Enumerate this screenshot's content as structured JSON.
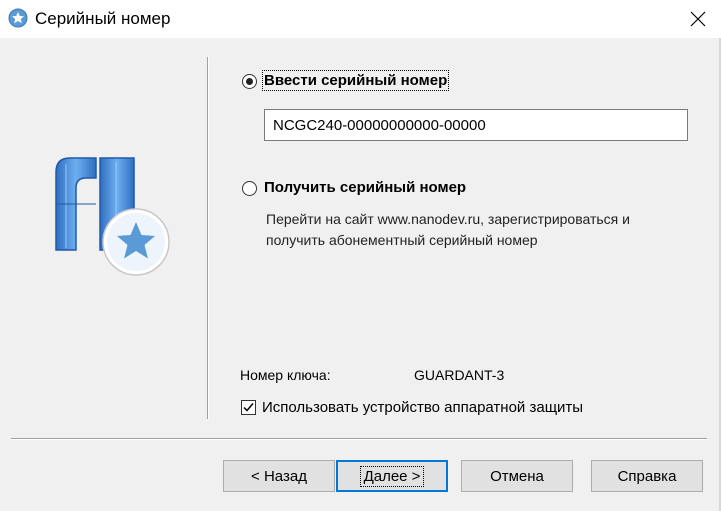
{
  "window": {
    "title": "Серийный номер",
    "close_glyph": "✕"
  },
  "options": {
    "enter_label": "Ввести серийный номер",
    "serial_value": "NCGC240-00000000000-00000",
    "get_label": "Получить серийный номер",
    "get_description": "Перейти на сайт www.nanodev.ru, зарегистрироваться и получить абонементный серийный номер"
  },
  "key": {
    "label": "Номер ключа:",
    "value": "GUARDANT-3"
  },
  "hardware": {
    "label": "Использовать устройство аппаратной защиты",
    "checked": true
  },
  "buttons": {
    "back": "< Назад",
    "next": "Далее >",
    "cancel": "Отмена",
    "help": "Справка"
  },
  "colors": {
    "accent": "#0078d7",
    "logo_blue": "#4a90d9",
    "star_blue": "#5b9bd5"
  }
}
